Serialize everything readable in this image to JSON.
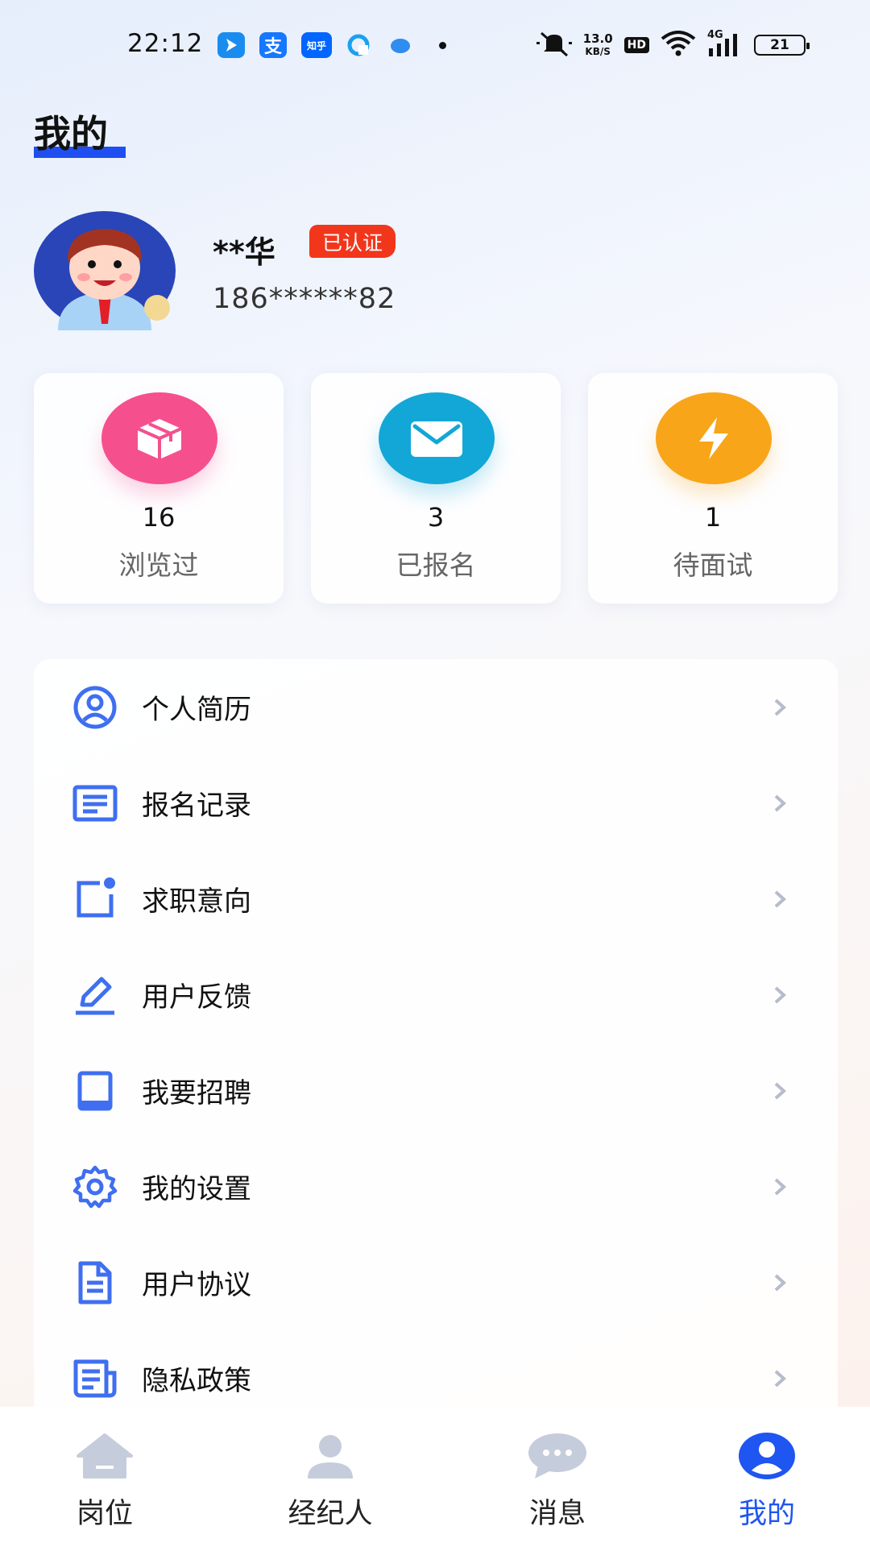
{
  "status_bar": {
    "time": "22:12",
    "net_speed_value": "13.0",
    "net_speed_unit": "KB/S",
    "hd": "HD",
    "signal": "4G",
    "battery": "21",
    "app_icons": [
      "arrow-app-icon",
      "alipay-icon",
      "zhihu-icon",
      "browser-icon",
      "cloud-icon"
    ],
    "zhihu_text": "知乎",
    "alipay_text": "支"
  },
  "header": {
    "title": "我的"
  },
  "profile": {
    "name": "**华",
    "badge": "已认证",
    "phone": "186******82"
  },
  "stats": [
    {
      "value": "16",
      "label": "浏览过",
      "icon": "box-icon",
      "color": "#f54f8e"
    },
    {
      "value": "3",
      "label": "已报名",
      "icon": "mail-icon",
      "color": "#12a7d6"
    },
    {
      "value": "1",
      "label": "待面试",
      "icon": "lightning-icon",
      "color": "#f8a519"
    }
  ],
  "menu": {
    "items": [
      {
        "label": "个人简历",
        "icon": "user-circle-icon"
      },
      {
        "label": "报名记录",
        "icon": "list-document-icon"
      },
      {
        "label": "求职意向",
        "icon": "notification-square-icon"
      },
      {
        "label": "用户反馈",
        "icon": "pen-icon"
      },
      {
        "label": "我要招聘",
        "icon": "square-icon"
      },
      {
        "label": "我的设置",
        "icon": "gear-icon"
      },
      {
        "label": "用户协议",
        "icon": "file-text-icon"
      },
      {
        "label": "隐私政策",
        "icon": "newspaper-icon"
      }
    ]
  },
  "tabs": [
    {
      "label": "岗位",
      "icon": "home-icon",
      "active": false
    },
    {
      "label": "经纪人",
      "icon": "person-icon",
      "active": false
    },
    {
      "label": "消息",
      "icon": "chat-icon",
      "active": false
    },
    {
      "label": "我的",
      "icon": "user-profile-icon",
      "active": true
    }
  ],
  "colors": {
    "accent": "#1f55f0",
    "badge": "#f2361c",
    "menu_icon": "#3f6ff0",
    "inactive_tab": "#c5ccdb"
  }
}
